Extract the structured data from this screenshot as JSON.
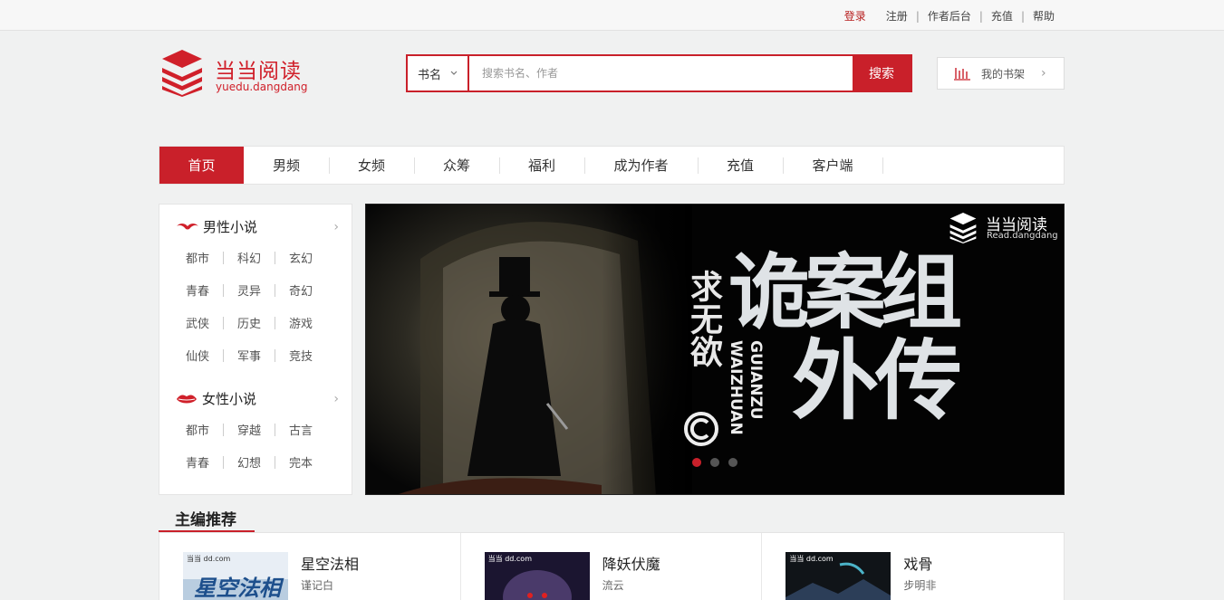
{
  "top": {
    "login": "登录",
    "register": "注册",
    "author_backend": "作者后台",
    "recharge": "充值",
    "help": "帮助"
  },
  "brand": {
    "name": "当当阅读",
    "domain": "yuedu.dangdang",
    "color": "#d0202a"
  },
  "search": {
    "type": "书名",
    "placeholder": "搜索书名、作者",
    "button": "搜索"
  },
  "shelf": {
    "label": "我的书架"
  },
  "nav": [
    {
      "label": "首页",
      "active": true
    },
    {
      "label": "男频"
    },
    {
      "label": "女频"
    },
    {
      "label": "众筹"
    },
    {
      "label": "福利"
    },
    {
      "label": "成为作者"
    },
    {
      "label": "充值"
    },
    {
      "label": "客户端"
    }
  ],
  "categories": {
    "male": {
      "title": "男性小说",
      "rows": [
        [
          "都市",
          "科幻",
          "玄幻"
        ],
        [
          "青春",
          "灵异",
          "奇幻"
        ],
        [
          "武侠",
          "历史",
          "游戏"
        ],
        [
          "仙侠",
          "军事",
          "竞技"
        ]
      ]
    },
    "female": {
      "title": "女性小说",
      "rows": [
        [
          "都市",
          "穿越",
          "古言"
        ],
        [
          "青春",
          "幻想",
          "完本"
        ]
      ]
    }
  },
  "banner": {
    "brand": "当当阅读",
    "brand_sub": "Read.dangdang",
    "author": "求无欲",
    "title_line1": "诡案组",
    "title_line2": "外传",
    "pinyin1": "GUIANZU",
    "pinyin2": "WAIZHUAN",
    "slides": 3,
    "active_slide": 0
  },
  "recommend": {
    "title": "主编推荐",
    "books": [
      {
        "name": "星空法相",
        "author": "谨记白",
        "cover_text": "星空法相",
        "cover_site": "当当 dd.com"
      },
      {
        "name": "降妖伏魔",
        "author": "流云",
        "cover_text": "",
        "cover_site": "当当 dd.com"
      },
      {
        "name": "戏骨",
        "author": "步明非",
        "cover_text": "",
        "cover_site": "当当 dd.com"
      }
    ]
  }
}
